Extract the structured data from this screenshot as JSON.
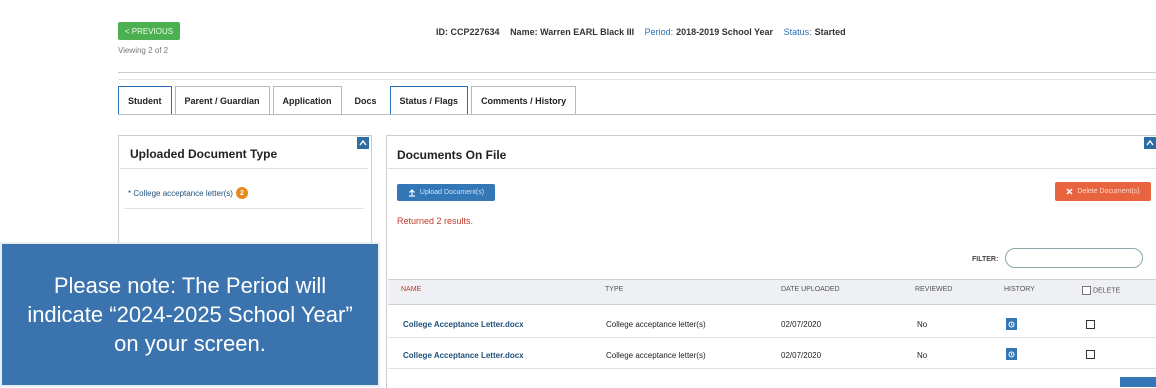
{
  "header": {
    "previous_label": "< PREVIOUS",
    "viewing": "Viewing 2 of 2",
    "id_text": "ID: CCP227634",
    "name_text": "Name: Warren EARL Black III",
    "period_label": "Period:",
    "period_value": "2018-2019 School Year",
    "status_label": "Status:",
    "status_value": "Started"
  },
  "tabs": [
    {
      "label": "Student"
    },
    {
      "label": "Parent / Guardian"
    },
    {
      "label": "Application"
    },
    {
      "label": "Docs"
    },
    {
      "label": "Status / Flags"
    },
    {
      "label": "Comments / History"
    }
  ],
  "left_panel": {
    "title": "Uploaded Document Type",
    "item_label": "* College acceptance letter(s)",
    "item_count": "2"
  },
  "right_panel": {
    "title": "Documents On File",
    "upload_label": "Upload Document(s)",
    "delete_label": "Delete Document(s)",
    "returned": "Returned 2 results.",
    "filter_label": "FILTER:",
    "filter_value": ""
  },
  "table": {
    "columns": [
      "NAME",
      "TYPE",
      "DATE UPLOADED",
      "REVIEWED",
      "HISTORY",
      "DELETE"
    ],
    "rows": [
      {
        "name": "College Acceptance Letter.docx",
        "type": "College acceptance letter(s)",
        "date": "02/07/2020",
        "reviewed": "No"
      },
      {
        "name": "College Acceptance Letter.docx",
        "type": "College acceptance letter(s)",
        "date": "02/07/2020",
        "reviewed": "No"
      }
    ]
  },
  "note": "Please note: The Period will indicate “2024-2025 School Year” on your screen.",
  "colors": {
    "accent_blue": "#3377b7",
    "previous_green": "#4caf50",
    "delete_orange": "#e8643f",
    "badge_orange": "#e48a1e",
    "note_blue": "#3a73ad"
  },
  "icons": {
    "upload": "upload-icon",
    "delete": "close-icon",
    "history": "history-icon",
    "collapse": "chevron-up-icon"
  }
}
